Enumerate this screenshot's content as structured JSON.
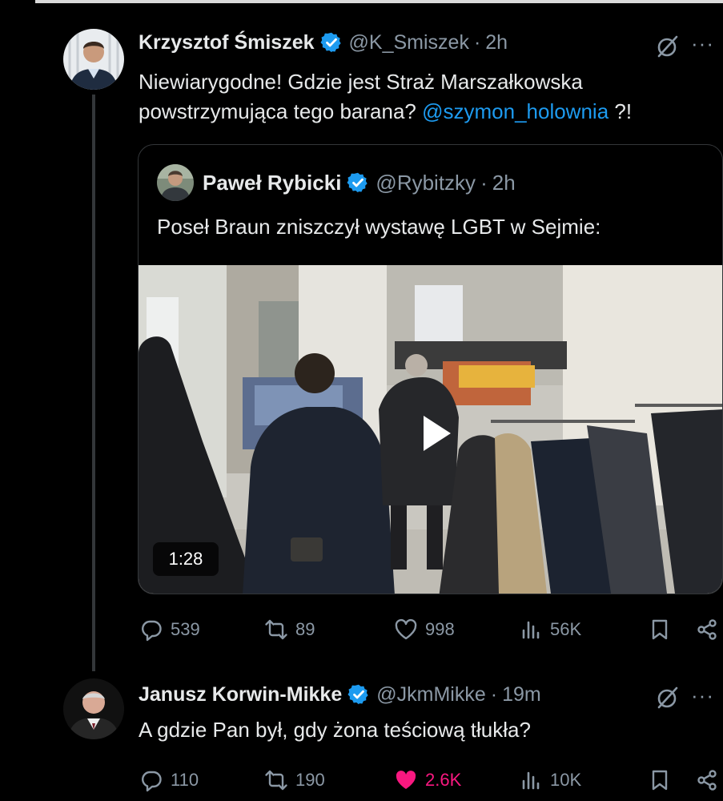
{
  "tweet": {
    "author_name": "Krzysztof Śmiszek",
    "handle": "@K_Smiszek",
    "separator": "·",
    "time": "2h",
    "text_before_mention": "Niewiarygodne! Gdzie jest Straż Marszałkowska powstrzymująca tego barana? ",
    "mention": "@szymon_holownia",
    "text_after_mention": " ?!",
    "more_label": "···",
    "quote": {
      "author_name": "Paweł Rybicki",
      "handle": "@Rybitzky",
      "separator": "·",
      "time": "2h",
      "text": "Poseł Braun zniszczył wystawę LGBT w Sejmie:",
      "video_duration": "1:28"
    },
    "stats": {
      "replies": "539",
      "reposts": "89",
      "likes": "998",
      "views": "56K"
    }
  },
  "reply": {
    "author_name": "Janusz Korwin-Mikke",
    "handle": "@JkmMikke",
    "separator": "·",
    "time": "19m",
    "text": "A gdzie Pan był, gdy żona teściową tłukła?",
    "more_label": "···",
    "stats": {
      "replies": "110",
      "reposts": "190",
      "likes": "2.6K",
      "views": "10K"
    }
  },
  "icons": [
    "verified-badge-icon",
    "grok-icon",
    "more-icon",
    "reply-icon",
    "repost-icon",
    "like-icon",
    "views-icon",
    "bookmark-icon",
    "share-icon",
    "play-icon"
  ],
  "colors": {
    "background": "#000000",
    "text": "#e7e9ea",
    "secondary_text": "#8b98a5",
    "mention": "#1d9bf0",
    "verified": "#1d9bf0",
    "liked": "#f91880",
    "border": "#333639"
  }
}
